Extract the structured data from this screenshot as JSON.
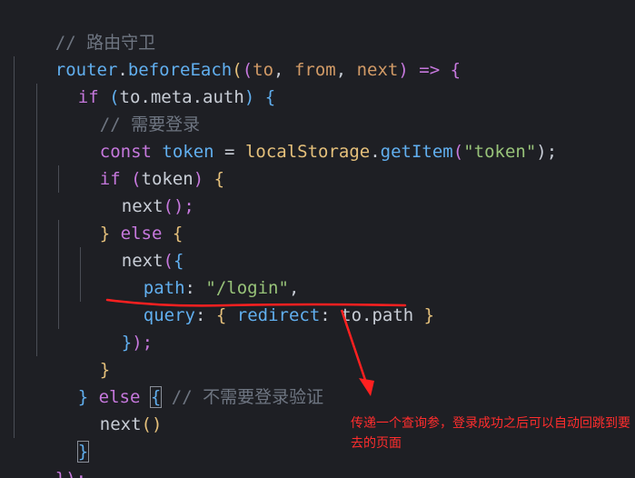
{
  "code": {
    "l1": {
      "comment": "// 路由守卫"
    },
    "l2": {
      "obj": "router",
      "dot": ".",
      "method": "beforeEach",
      "p1": "(",
      "p2": "(",
      "a1": "to",
      "comma1": ", ",
      "a2": "from",
      "comma2": ", ",
      "a3": "next",
      "p3": ")",
      "arrow": " => ",
      "brace": "{"
    },
    "l3": {
      "kw": "if",
      "open": " (",
      "expr": "to.meta.auth",
      "close": ") ",
      "brace": "{"
    },
    "l4": {
      "comment": "// 需要登录"
    },
    "l5": {
      "kw": "const",
      "name": " token",
      "eq": " = ",
      "obj": "localStorage",
      "dot": ".",
      "method": "getItem",
      "open": "(",
      "str": "\"token\"",
      "close": ");"
    },
    "l6": {
      "kw": "if",
      "open": " (",
      "expr": "token",
      "close": ") ",
      "brace": "{"
    },
    "l7": {
      "fn": "next",
      "call": "();"
    },
    "l8": {
      "brace1": "}",
      "kw": " else ",
      "brace2": "{"
    },
    "l9": {
      "fn": "next",
      "open": "(",
      "brace": "{"
    },
    "l10": {
      "key": "path",
      "colon": ": ",
      "str": "\"/login\"",
      "comma": ","
    },
    "l11": {
      "key": "query",
      "colon": ": ",
      "brace1": "{",
      "inner_key": " redirect",
      "inner_colon": ": ",
      "val": "to.path",
      "brace2": " }"
    },
    "l12": {
      "brace": "}",
      "close": ");"
    },
    "l13": {
      "brace": "}"
    },
    "l14": {
      "brace1": "}",
      "kw": " else ",
      "brace2": "{",
      "comment": " // 不需要登录验证"
    },
    "l15": {
      "fn": "next",
      "call": "()"
    },
    "l16": {
      "brace": "}"
    },
    "l17": {
      "text": "});"
    }
  },
  "annotation": {
    "text": "传递一个查询参，登录成功之后可以自动回跳到要去的页面",
    "color": "#ff2d2d"
  }
}
